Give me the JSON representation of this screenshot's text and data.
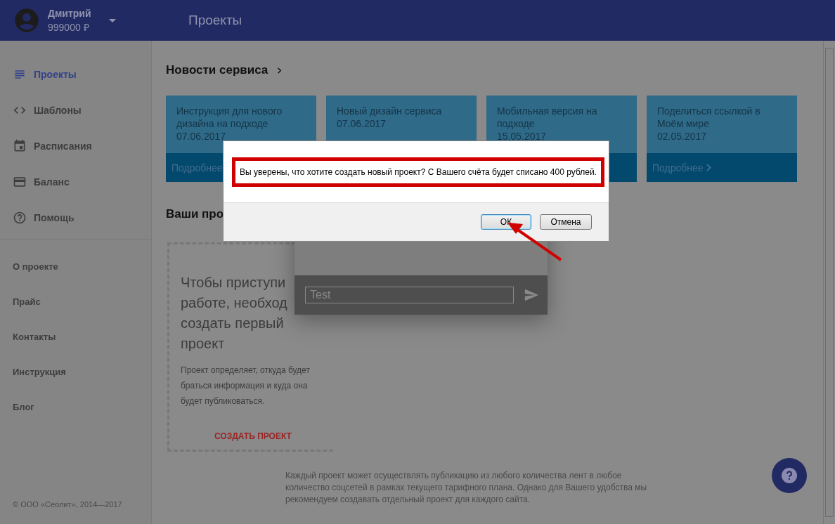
{
  "header": {
    "user": {
      "name": "Дмитрий",
      "balance": "999000 ₽"
    },
    "page_title": "Проекты"
  },
  "sidebar": {
    "nav": [
      {
        "kind": "list",
        "label": "Проекты",
        "selected": true
      },
      {
        "kind": "code",
        "label": "Шаблоны",
        "selected": false
      },
      {
        "kind": "calendar",
        "label": "Расписания",
        "selected": false
      },
      {
        "kind": "card",
        "label": "Баланс",
        "selected": false
      },
      {
        "kind": "help",
        "label": "Помощь",
        "selected": false
      }
    ],
    "links": [
      "О проекте",
      "Прайс",
      "Контакты",
      "Инструкция",
      "Блог"
    ],
    "copyright": "© ООО «Сеолит», 2014—2017"
  },
  "news": {
    "title": "Новости сервиса",
    "cards": [
      {
        "title": "Инструкция для нового дизайна на подходе",
        "date": "07.06.2017",
        "more": "Подробнее"
      },
      {
        "title": "Новый дизайн сервиса",
        "date": "07.06.2017"
      },
      {
        "title": "Мобильная версия на подходе",
        "date": "15.05.2017"
      },
      {
        "title": "Поделиться ссылкой в Моём мире",
        "date": "02.05.2017",
        "more": "Подробнее"
      }
    ]
  },
  "projects": {
    "heading": "Ваши про",
    "empty_card": {
      "headline_lines": [
        "Чтобы приступи",
        "работе, необход",
        "создать первый",
        "проект"
      ],
      "description": "Проект определяет, откуда будет браться информация и куда она будет публиковаться.",
      "action": "СОЗДАТЬ ПРОЕКТ"
    },
    "note": "Каждый проект может осуществлять публикацию из любого количества лент в любое количество соцсетей в рамках текущего тарифного плана. Однако для Вашего удобства мы рекомендуем создавать отдельный проект для каждого сайта."
  },
  "chat": {
    "placeholder": "Test"
  },
  "dialog": {
    "message": "Вы уверены, что хотите создать новый проект? С Вашего счёта будет списано 400 рублей.",
    "buttons": [
      {
        "label": "ОК",
        "selected": true
      },
      {
        "label": "Отмена",
        "selected": false
      }
    ]
  }
}
